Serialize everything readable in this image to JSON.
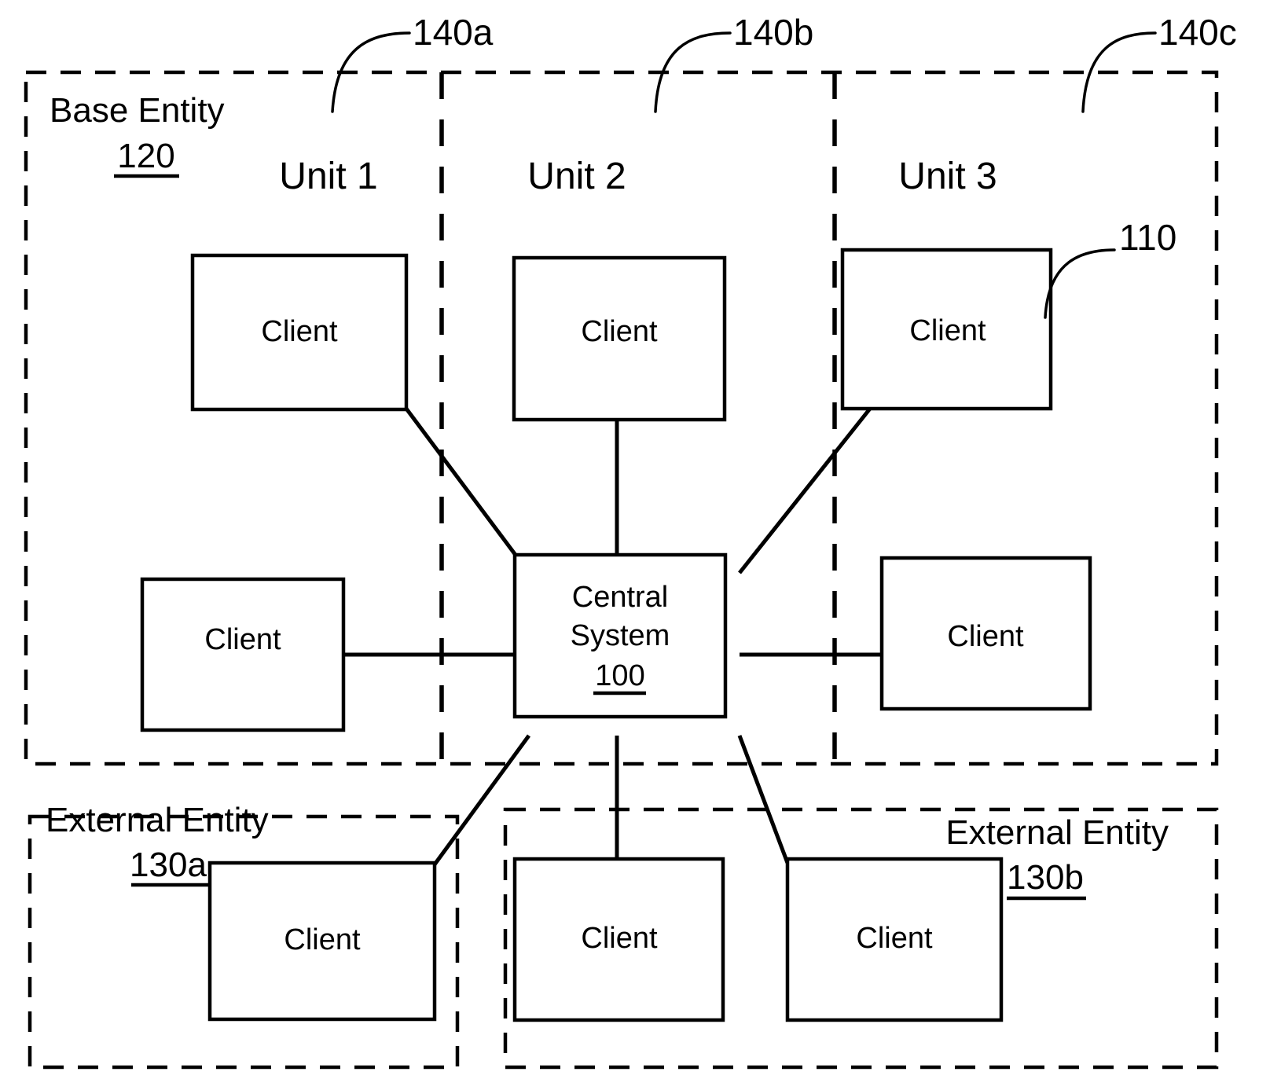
{
  "figure": {
    "title": "Central System Network Diagram",
    "background_color": "#ffffff",
    "line_color": "#000000"
  },
  "regions": {
    "base_entity": {
      "label": "Base Entity",
      "ref": "120",
      "style": "dashed"
    },
    "external_entity_a": {
      "label": "External Entity",
      "ref": "130a",
      "style": "dashed"
    },
    "external_entity_b": {
      "label": "External Entity",
      "ref": "130b",
      "style": "dashed"
    }
  },
  "units": [
    {
      "label": "Unit 1",
      "callout": "140a"
    },
    {
      "label": "Unit 2",
      "callout": "140b"
    },
    {
      "label": "Unit 3",
      "callout": "140c"
    }
  ],
  "central_system": {
    "line1": "Central",
    "line2": "System",
    "ref": "100"
  },
  "client_callout": {
    "ref": "110"
  },
  "clients": [
    {
      "label": "Client",
      "position": "unit1-top"
    },
    {
      "label": "Client",
      "position": "unit2-top"
    },
    {
      "label": "Client",
      "position": "unit3-top"
    },
    {
      "label": "Client",
      "position": "unit1-middle"
    },
    {
      "label": "Client",
      "position": "unit3-middle"
    },
    {
      "label": "Client",
      "position": "external-a"
    },
    {
      "label": "Client",
      "position": "external-b-left"
    },
    {
      "label": "Client",
      "position": "external-b-right"
    }
  ],
  "connections": [
    {
      "from": "unit1-top",
      "to": "central-system"
    },
    {
      "from": "unit2-top",
      "to": "central-system"
    },
    {
      "from": "unit3-top",
      "to": "central-system"
    },
    {
      "from": "unit1-middle",
      "to": "central-system"
    },
    {
      "from": "unit3-middle",
      "to": "central-system"
    },
    {
      "from": "external-a",
      "to": "central-system"
    },
    {
      "from": "external-b-left",
      "to": "central-system"
    },
    {
      "from": "external-b-right",
      "to": "central-system"
    }
  ]
}
